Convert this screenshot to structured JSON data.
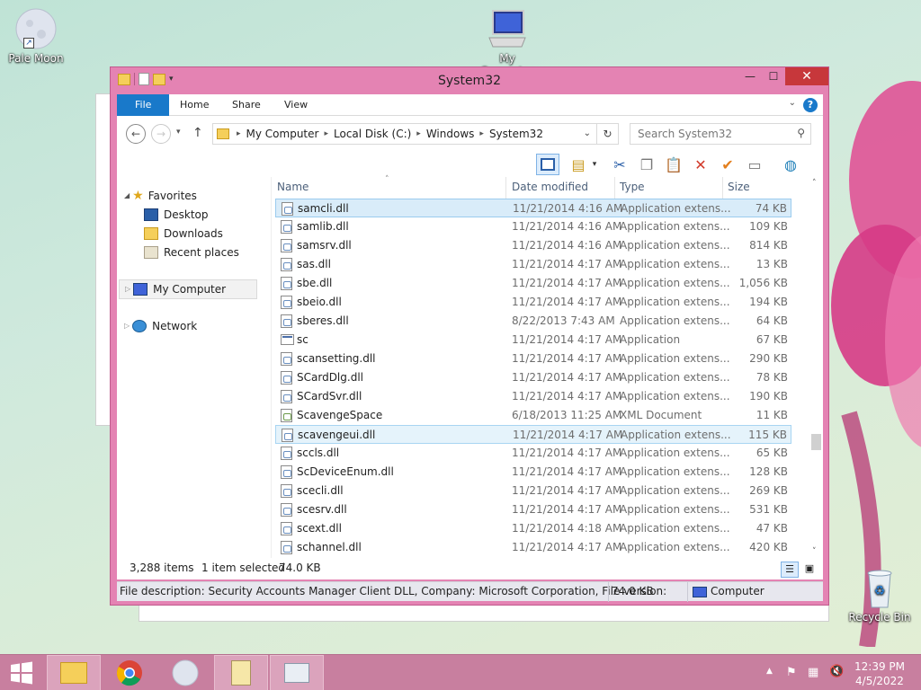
{
  "desktop": {
    "icons": [
      {
        "label": "Pale Moon"
      },
      {
        "label": "My Computer"
      },
      {
        "label": "Recycle Bin"
      }
    ]
  },
  "window": {
    "title": "System32",
    "minimize": "—",
    "maximize": "☐",
    "close": "✕"
  },
  "ribbon": {
    "tabs": [
      "File",
      "Home",
      "Share",
      "View"
    ],
    "help": "?"
  },
  "address": {
    "crumbs": [
      "My Computer",
      "Local Disk (C:)",
      "Windows",
      "System32"
    ],
    "search_placeholder": "Search System32"
  },
  "nav": {
    "favorites": "Favorites",
    "desktop": "Desktop",
    "downloads": "Downloads",
    "recent": "Recent places",
    "computer": "My Computer",
    "network": "Network"
  },
  "columns": {
    "name": "Name",
    "date": "Date modified",
    "type": "Type",
    "size": "Size"
  },
  "files": [
    {
      "name": "samcli.dll",
      "date": "11/21/2014 4:16 AM",
      "type": "Application extens...",
      "size": "74 KB",
      "kind": "dll",
      "state": "selected"
    },
    {
      "name": "samlib.dll",
      "date": "11/21/2014 4:16 AM",
      "type": "Application extens...",
      "size": "109 KB",
      "kind": "dll",
      "state": ""
    },
    {
      "name": "samsrv.dll",
      "date": "11/21/2014 4:16 AM",
      "type": "Application extens...",
      "size": "814 KB",
      "kind": "dll",
      "state": ""
    },
    {
      "name": "sas.dll",
      "date": "11/21/2014 4:17 AM",
      "type": "Application extens...",
      "size": "13 KB",
      "kind": "dll",
      "state": ""
    },
    {
      "name": "sbe.dll",
      "date": "11/21/2014 4:17 AM",
      "type": "Application extens...",
      "size": "1,056 KB",
      "kind": "dll",
      "state": ""
    },
    {
      "name": "sbeio.dll",
      "date": "11/21/2014 4:17 AM",
      "type": "Application extens...",
      "size": "194 KB",
      "kind": "dll",
      "state": ""
    },
    {
      "name": "sberes.dll",
      "date": "8/22/2013 7:43 AM",
      "type": "Application extens...",
      "size": "64 KB",
      "kind": "dll",
      "state": ""
    },
    {
      "name": "sc",
      "date": "11/21/2014 4:17 AM",
      "type": "Application",
      "size": "67 KB",
      "kind": "app",
      "state": ""
    },
    {
      "name": "scansetting.dll",
      "date": "11/21/2014 4:17 AM",
      "type": "Application extens...",
      "size": "290 KB",
      "kind": "dll",
      "state": ""
    },
    {
      "name": "SCardDlg.dll",
      "date": "11/21/2014 4:17 AM",
      "type": "Application extens...",
      "size": "78 KB",
      "kind": "dll",
      "state": ""
    },
    {
      "name": "SCardSvr.dll",
      "date": "11/21/2014 4:17 AM",
      "type": "Application extens...",
      "size": "190 KB",
      "kind": "dll",
      "state": ""
    },
    {
      "name": "ScavengeSpace",
      "date": "6/18/2013 11:25 AM",
      "type": "XML Document",
      "size": "11 KB",
      "kind": "xml",
      "state": ""
    },
    {
      "name": "scavengeui.dll",
      "date": "11/21/2014 4:17 AM",
      "type": "Application extens...",
      "size": "115 KB",
      "kind": "dll",
      "state": "hover"
    },
    {
      "name": "sccls.dll",
      "date": "11/21/2014 4:17 AM",
      "type": "Application extens...",
      "size": "65 KB",
      "kind": "dll",
      "state": ""
    },
    {
      "name": "ScDeviceEnum.dll",
      "date": "11/21/2014 4:17 AM",
      "type": "Application extens...",
      "size": "128 KB",
      "kind": "dll",
      "state": ""
    },
    {
      "name": "scecli.dll",
      "date": "11/21/2014 4:17 AM",
      "type": "Application extens...",
      "size": "269 KB",
      "kind": "dll",
      "state": ""
    },
    {
      "name": "scesrv.dll",
      "date": "11/21/2014 4:17 AM",
      "type": "Application extens...",
      "size": "531 KB",
      "kind": "dll",
      "state": ""
    },
    {
      "name": "scext.dll",
      "date": "11/21/2014 4:18 AM",
      "type": "Application extens...",
      "size": "47 KB",
      "kind": "dll",
      "state": ""
    },
    {
      "name": "schannel.dll",
      "date": "11/21/2014 4:17 AM",
      "type": "Application extens...",
      "size": "420 KB",
      "kind": "dll",
      "state": ""
    }
  ],
  "status": {
    "items": "3,288 items",
    "selected": "1 item selected",
    "size": "74.0 KB"
  },
  "details": {
    "description": "File description: Security Accounts Manager Client DLL, Company: Microsoft Corporation, File version:",
    "size": "74.0 KB",
    "location": "Computer"
  },
  "taskbar": {
    "time": "12:39 PM",
    "date": "4/5/2022"
  },
  "colors": {
    "window_frame": "#e483b3",
    "taskbar": "#c87f9f",
    "accent": "#1979ca",
    "selection": "#d9ecf9"
  }
}
